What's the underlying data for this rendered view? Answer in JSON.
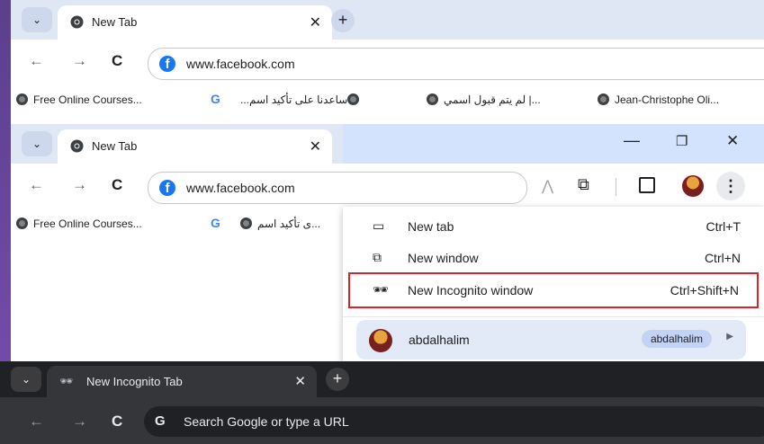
{
  "back_window": {
    "tab_title": "New Tab",
    "url": "www.facebook.com",
    "bookmarks": [
      "Free Online Courses...",
      "ساعدنا على تأكيد اسم...",
      "لم يتم قبول اسمي |...",
      "Jean-Christophe Oli..."
    ]
  },
  "front_window": {
    "tab_title": "New Tab",
    "url": "www.facebook.com",
    "bookmarks": [
      "Free Online Courses...",
      "ى تأكيد اسم..."
    ]
  },
  "menu": {
    "items": [
      {
        "icon": "new-tab-icon",
        "label": "New tab",
        "shortcut": "Ctrl+T"
      },
      {
        "icon": "new-window-icon",
        "label": "New window",
        "shortcut": "Ctrl+N"
      },
      {
        "icon": "incognito-icon",
        "label": "New Incognito window",
        "shortcut": "Ctrl+Shift+N"
      }
    ],
    "profile_name": "abdalhalim",
    "profile_badge": "abdalhalim"
  },
  "incognito_window": {
    "tab_title": "New Incognito Tab",
    "omnibox_placeholder": "Search Google or type a URL"
  },
  "colors": {
    "highlight": "#d9222a",
    "incognito_bg": "#35363a",
    "menu_highlight": "#e3eaf7"
  }
}
